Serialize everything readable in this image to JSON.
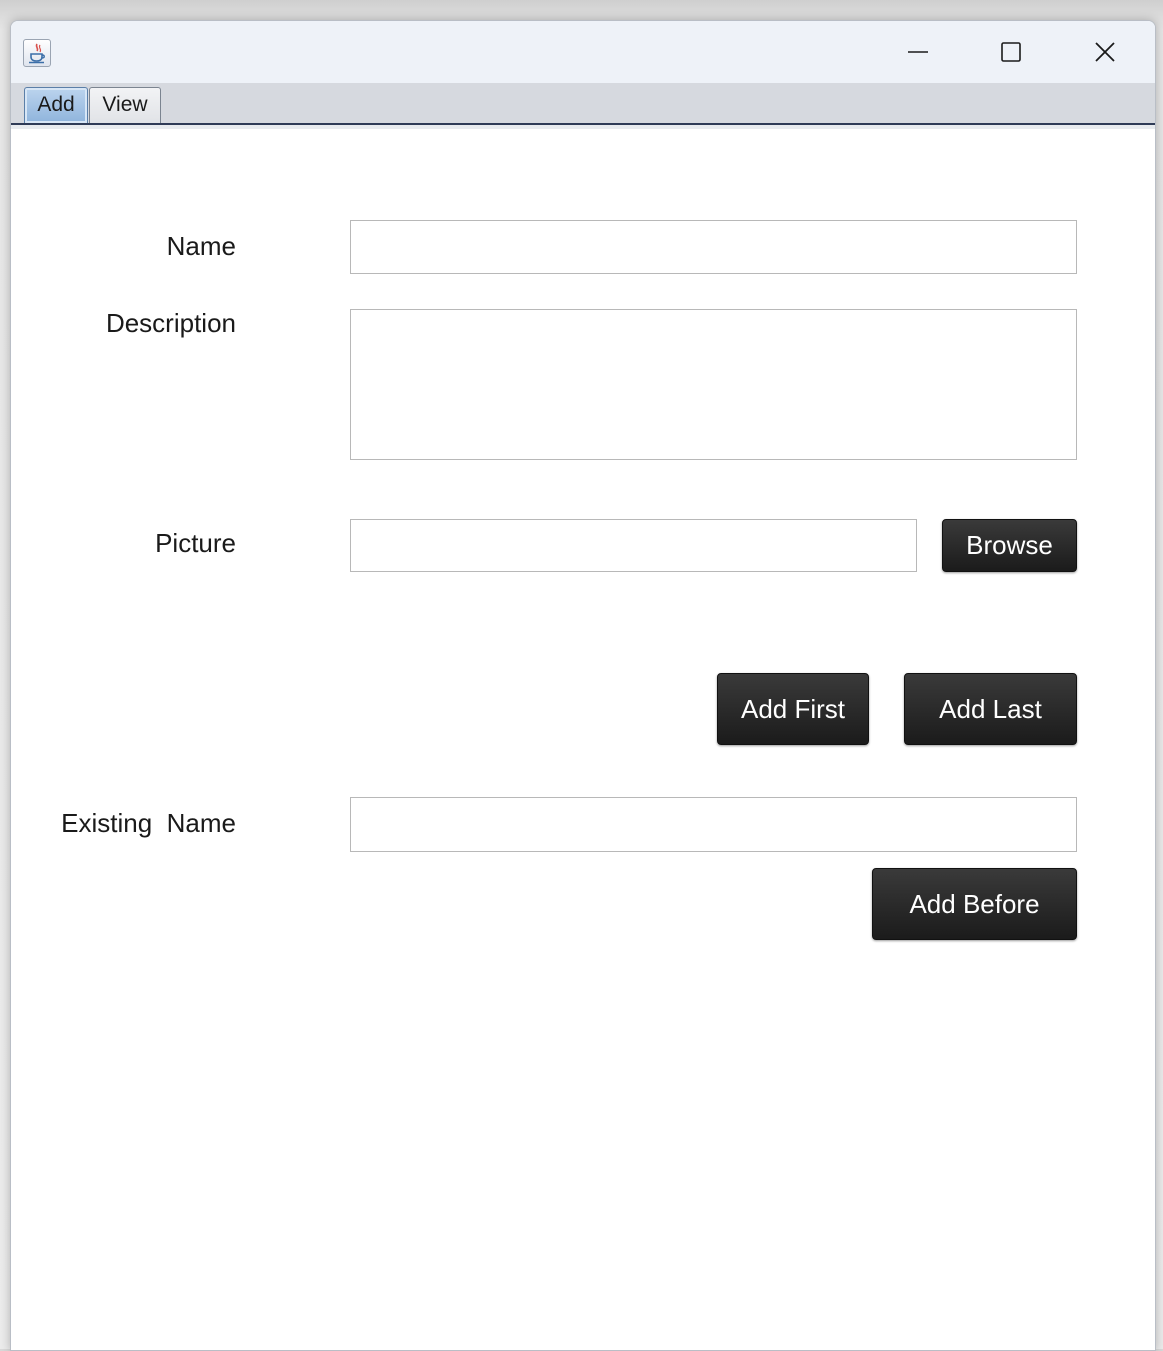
{
  "window": {
    "app_icon": "java-cup-icon",
    "controls": {
      "minimize_icon": "minimize-icon",
      "maximize_icon": "maximize-icon",
      "close_icon": "close-icon"
    }
  },
  "tabs": [
    {
      "label": "Add",
      "selected": true
    },
    {
      "label": "View",
      "selected": false
    }
  ],
  "form": {
    "name_label": "Name",
    "name_value": "",
    "description_label": "Description",
    "description_value": "",
    "picture_label": "Picture",
    "picture_value": "",
    "browse_label": "Browse",
    "add_first_label": "Add First",
    "add_last_label": "Add Last",
    "existing_name_label": "Existing  Name",
    "existing_name_value": "",
    "add_before_label": "Add Before"
  },
  "colors": {
    "button_background": "#1f1f1f",
    "button_text": "#ffffff",
    "selected_tab": "#9dbfe3",
    "tab_strip": "#d6d9df"
  }
}
